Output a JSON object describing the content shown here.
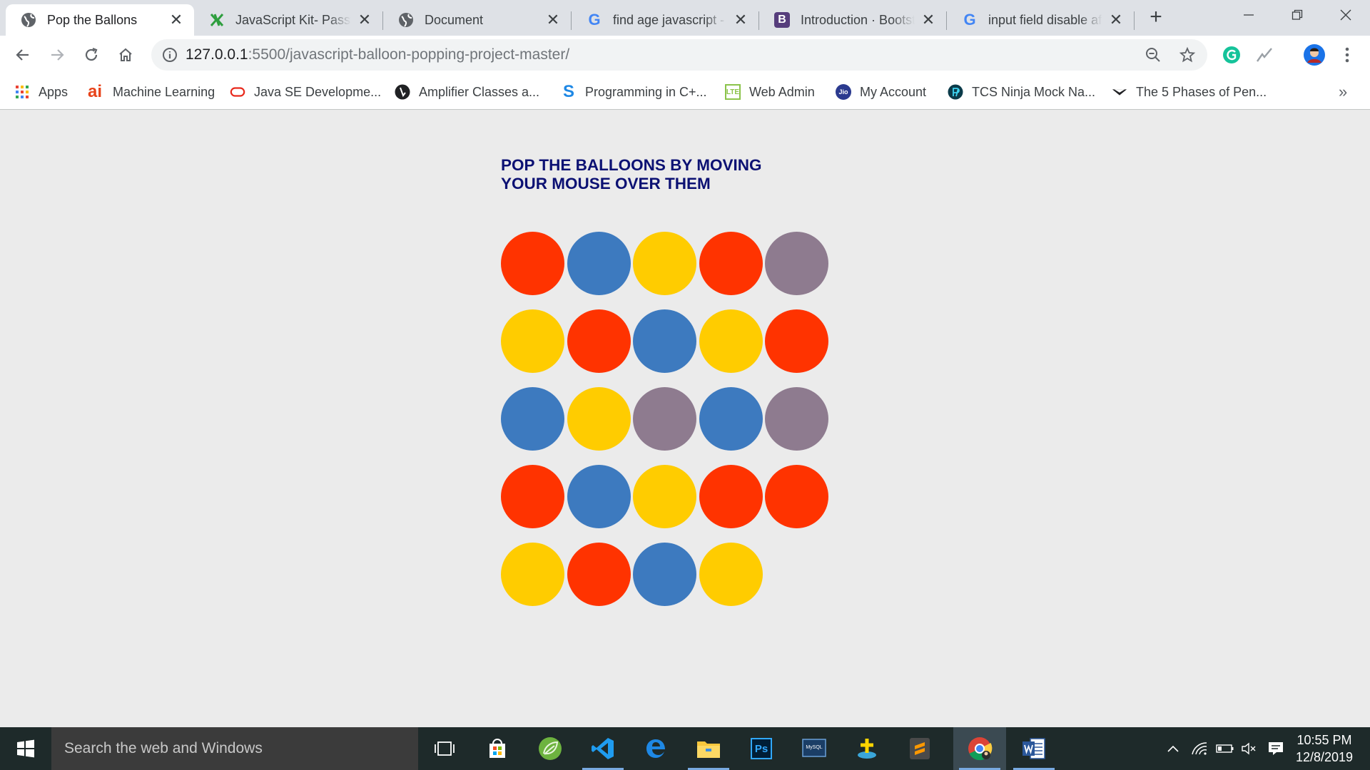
{
  "browser": {
    "tabs": [
      {
        "title": "Pop the Ballons",
        "icon": "globe-icon",
        "active": true
      },
      {
        "title": "JavaScript Kit- Passw",
        "icon": "jskit-icon",
        "active": false
      },
      {
        "title": "Document",
        "icon": "globe-icon",
        "active": false
      },
      {
        "title": "find age javascript - G",
        "icon": "google-icon",
        "active": false
      },
      {
        "title": "Introduction · Bootstr",
        "icon": "bootstrap-icon",
        "active": false
      },
      {
        "title": "input field disable af",
        "icon": "google-icon",
        "active": false
      }
    ],
    "address": {
      "host": "127.0.0.1",
      "path": ":5500/javascript-balloon-popping-project-master/"
    },
    "bookmarks": [
      {
        "label": "Apps",
        "icon": "apps-grid-icon"
      },
      {
        "label": "Machine Learning",
        "icon": "ai-icon"
      },
      {
        "label": "Java SE Developme...",
        "icon": "oracle-icon"
      },
      {
        "label": "Amplifier Classes a...",
        "icon": "amplifier-icon"
      },
      {
        "label": "Programming in C+...",
        "icon": "sololearn-icon"
      },
      {
        "label": "Web Admin",
        "icon": "lte-icon"
      },
      {
        "label": "My Account",
        "icon": "jio-icon"
      },
      {
        "label": "TCS Ninja Mock Na...",
        "icon": "prepinsta-icon"
      },
      {
        "label": "The 5 Phases of Pen...",
        "icon": "bookmark-icon"
      }
    ]
  },
  "page": {
    "heading_line1": "POP THE BALLOONS BY MOVING",
    "heading_line2": "YOUR MOUSE OVER THEM",
    "palette": {
      "red": "#ff3300",
      "blue": "#3d7abf",
      "yellow": "#ffcc00",
      "mauve": "#8e7b8f"
    },
    "balloons": [
      "red",
      "blue",
      "yellow",
      "red",
      "mauve",
      "yellow",
      "red",
      "blue",
      "yellow",
      "red",
      "blue",
      "yellow",
      "mauve",
      "blue",
      "mauve",
      "red",
      "blue",
      "yellow",
      "red",
      "red",
      "yellow",
      "red",
      "blue",
      "yellow"
    ]
  },
  "taskbar": {
    "search_placeholder": "Search the web and Windows",
    "time": "10:55 PM",
    "date": "12/8/2019"
  }
}
